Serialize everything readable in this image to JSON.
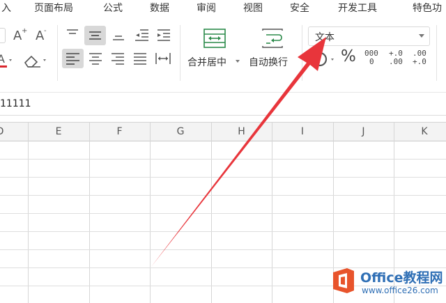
{
  "menu": {
    "items": [
      {
        "label": "入"
      },
      {
        "label": "页面布局"
      },
      {
        "label": "公式"
      },
      {
        "label": "数据"
      },
      {
        "label": "审阅"
      },
      {
        "label": "视图"
      },
      {
        "label": "安全"
      },
      {
        "label": "开发工具"
      },
      {
        "label": "特色功"
      }
    ]
  },
  "ribbon": {
    "merge_label": "合并居中",
    "wrap_label": "自动换行",
    "number_format": {
      "value": "文本"
    },
    "percent_symbol": "%",
    "thousands_top": "000",
    "thousands_bottom": "0",
    "inc_decimal_top": "+.0",
    "inc_decimal_bottom": ".00",
    "dec_decimal_top": ".00",
    "dec_decimal_bottom": "+.0"
  },
  "formula_bar": {
    "content": "11111"
  },
  "grid": {
    "columns": [
      "D",
      "E",
      "F",
      "G",
      "H",
      "I",
      "J",
      "K"
    ]
  },
  "annotation": {
    "arrow_color": "#e8353b"
  },
  "watermark": {
    "brand": "Office教程网",
    "url": "www.office26.com"
  }
}
